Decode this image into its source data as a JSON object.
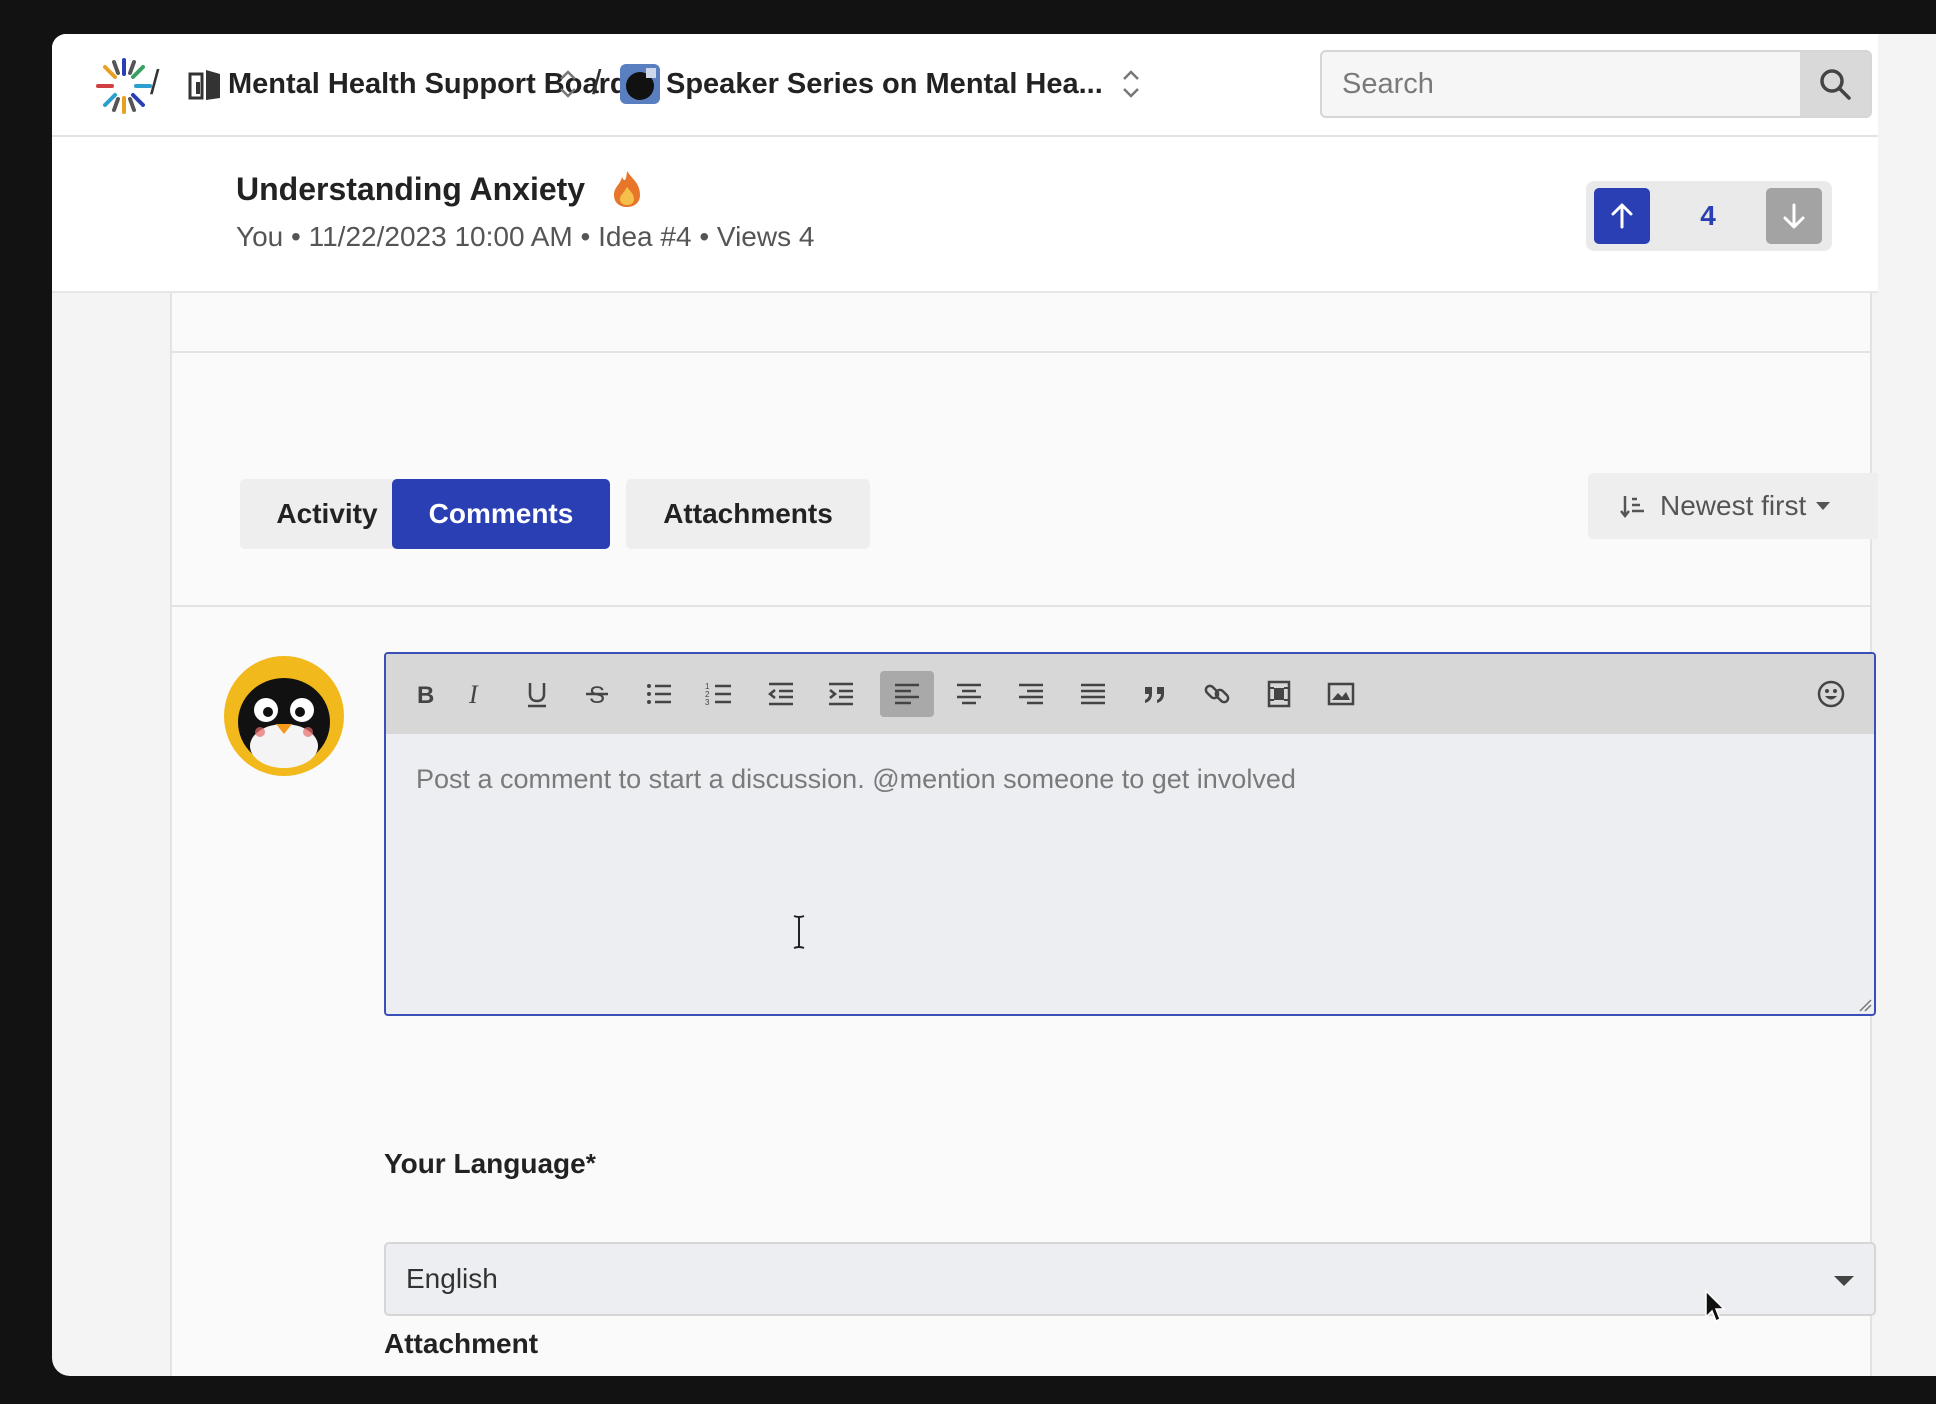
{
  "breadcrumb": {
    "separator": "/",
    "board": "Mental Health Support Board",
    "campaign": "Speaker Series on Mental Hea..."
  },
  "search": {
    "placeholder": "Search"
  },
  "idea": {
    "title": "Understanding Anxiety",
    "meta": "You • 11/22/2023 10:00 AM • Idea #4 • Views 4",
    "vote_count": "4"
  },
  "tabs": [
    {
      "label": "Activity",
      "active": false
    },
    {
      "label": "Comments",
      "active": true
    },
    {
      "label": "Attachments",
      "active": false
    }
  ],
  "sort": {
    "label": "Newest first"
  },
  "editor": {
    "placeholder": "Post a comment to start a discussion. @mention someone to get involved",
    "toolbar": [
      "bold-icon",
      "italic-icon",
      "underline-icon",
      "strikethrough-icon",
      "bullet-list-icon",
      "numbered-list-icon",
      "outdent-icon",
      "indent-icon",
      "align-left-icon",
      "align-center-icon",
      "align-right-icon",
      "justify-icon",
      "blockquote-icon",
      "link-icon",
      "video-icon",
      "image-icon",
      "emoji-icon"
    ]
  },
  "language": {
    "label": "Your Language",
    "required_mark": "*",
    "value": "English"
  },
  "attachment": {
    "label": "Attachment"
  },
  "colors": {
    "accent": "#2a3fb4",
    "downvote": "#a3a3a3"
  }
}
